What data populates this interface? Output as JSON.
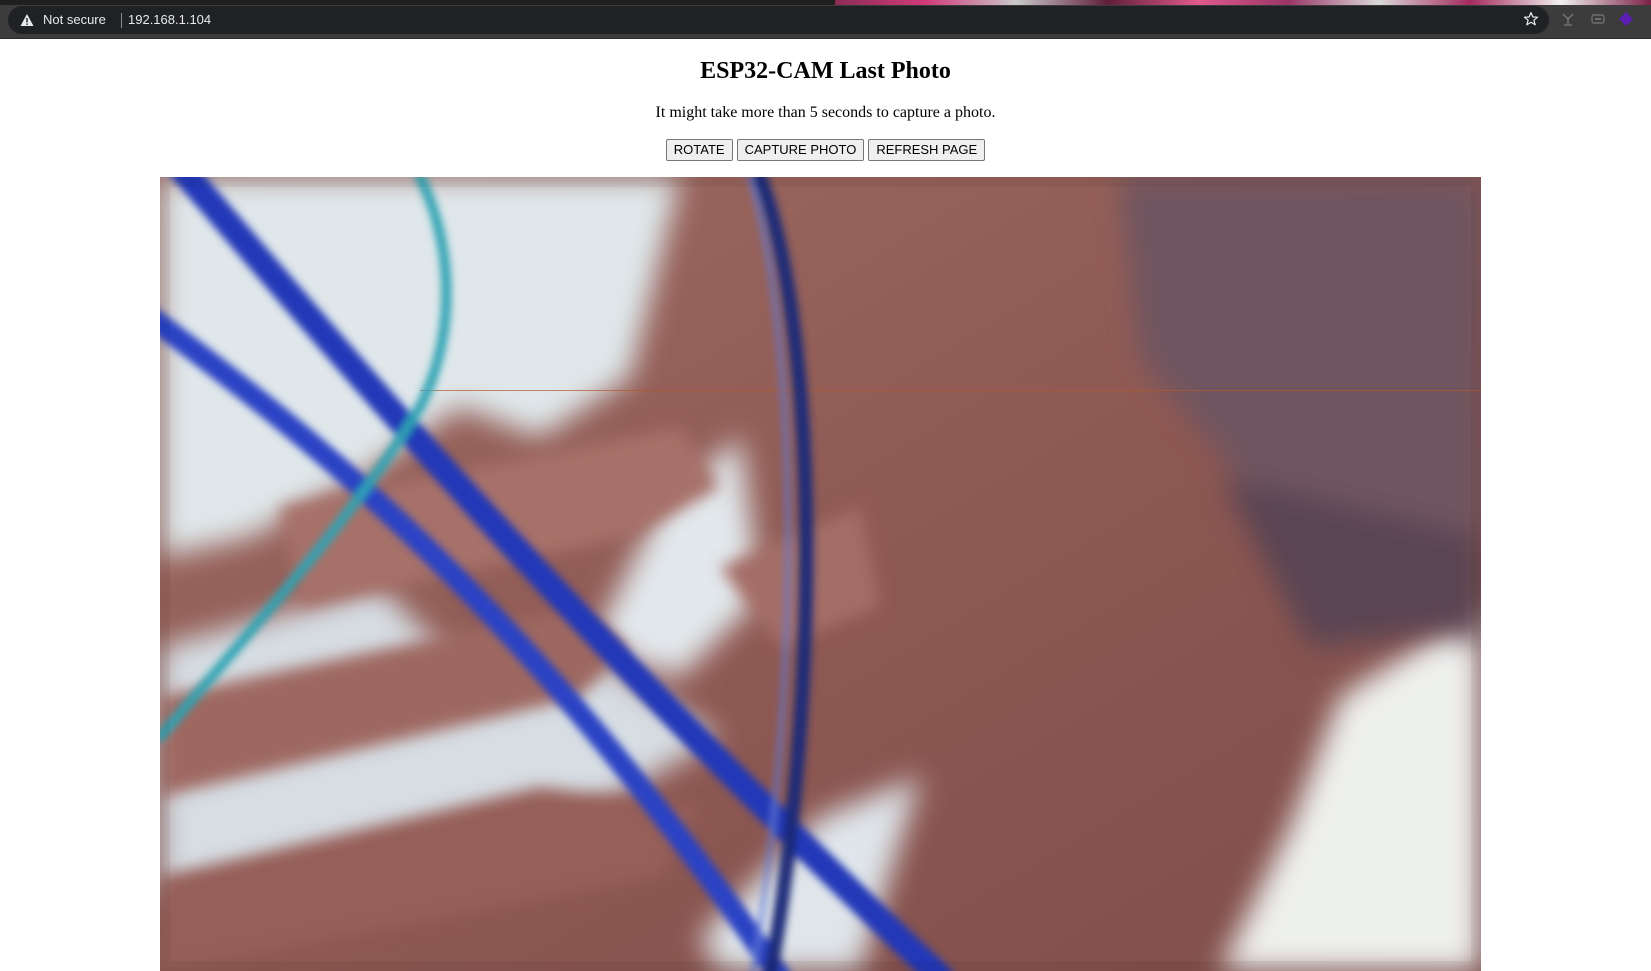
{
  "browser": {
    "security_label": "Not secure",
    "url": "192.168.1.104",
    "icons": {
      "security": "warning-triangle-icon",
      "bookmark": "star-icon",
      "extensions": [
        "extension-icon-1",
        "extension-icon-2",
        "extension-icon-3"
      ]
    },
    "colors": {
      "frame": "#3c3c3c",
      "omnibox": "#202124",
      "text": "#e8eaed"
    }
  },
  "page": {
    "title": "ESP32-CAM Last Photo",
    "info_text": "It might take more than 5 seconds to capture a photo.",
    "buttons": {
      "rotate": "ROTATE",
      "capture": "CAPTURE PHOTO",
      "refresh": "REFRESH PAGE"
    }
  }
}
